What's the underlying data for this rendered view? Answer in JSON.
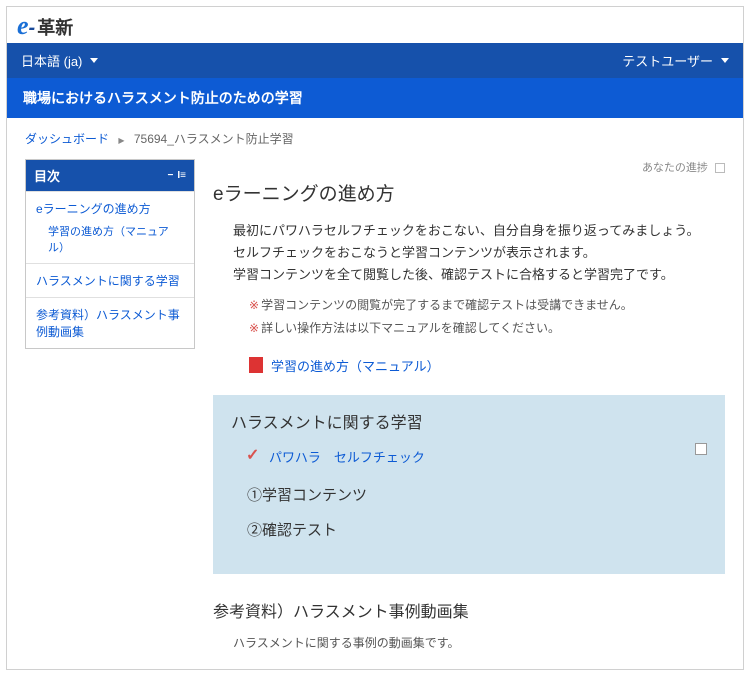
{
  "logo": {
    "e": "e",
    "dash": "-",
    "kan": "革新"
  },
  "navbar": {
    "lang": "日本語 (ja)",
    "user": "テストユーザー"
  },
  "titlebar": "職場におけるハラスメント防止のための学習",
  "breadcrumb": {
    "dash": "ダッシュボード",
    "current": "75694_ハラスメント防止学習"
  },
  "sidebar": {
    "title": "目次",
    "sec1": {
      "title": "eラーニングの進め方",
      "sub": "学習の進め方（マニュアル）"
    },
    "sec2": {
      "title": "ハラスメントに関する学習"
    },
    "sec3": {
      "title": "参考資料）ハラスメント事例動画集"
    }
  },
  "progress_label": "あなたの進捗",
  "intro": {
    "heading": "eラーニングの進め方",
    "p1": "最初にパワハラセルフチェックをおこない、自分自身を振り返ってみましょう。",
    "p2": "セルフチェックをおこなうと学習コンテンツが表示されます。",
    "p3": "学習コンテンツを全て閲覧した後、確認テストに合格すると学習完了です。",
    "note1": "学習コンテンツの閲覧が完了するまで確認テストは受講できません。",
    "note2": "詳しい操作方法は以下マニュアルを確認してください。",
    "star": "※",
    "pdf_label": "学習の進め方（マニュアル）"
  },
  "panel": {
    "heading": "ハラスメントに関する学習",
    "selfcheck": "パワハラ　セルフチェック",
    "sub1": "①学習コンテンツ",
    "sub2": "②確認テスト"
  },
  "ref": {
    "heading": "参考資料）ハラスメント事例動画集",
    "sub": "ハラスメントに関する事例の動画集です。"
  }
}
